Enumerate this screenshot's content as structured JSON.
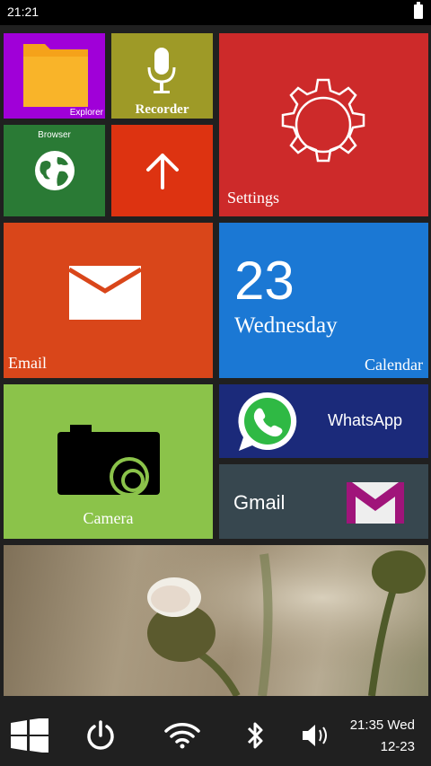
{
  "status_bar": {
    "time": "21:21"
  },
  "tiles": {
    "explorer": {
      "label": "Explorer",
      "color": "#a000d8"
    },
    "recorder": {
      "label": "Recorder",
      "color": "#9e9a27"
    },
    "browser": {
      "label": "Browser",
      "color": "#2a7a35"
    },
    "upload": {
      "icon": "arrow-up-icon",
      "color": "#dd3311"
    },
    "settings": {
      "label": "Settings",
      "color": "#cd2a2a"
    },
    "email": {
      "label": "Email",
      "color": "#d9461a"
    },
    "calendar": {
      "day_number": "23",
      "weekday": "Wednesday",
      "label": "Calendar",
      "color": "#1b78d4"
    },
    "camera": {
      "label": "Camera",
      "color": "#8bc34a"
    },
    "whatsapp": {
      "label": "WhatsApp",
      "color": "#1b2a7a"
    },
    "gmail": {
      "label": "Gmail",
      "color": "#37474f"
    },
    "photo": {
      "description_icon": "flower-photo"
    }
  },
  "taskbar": {
    "icons": [
      "windows-start-icon",
      "power-icon",
      "wifi-icon",
      "bluetooth-icon",
      "volume-icon"
    ],
    "clock_time_day": "21:35 Wed",
    "clock_date": "12-23"
  }
}
